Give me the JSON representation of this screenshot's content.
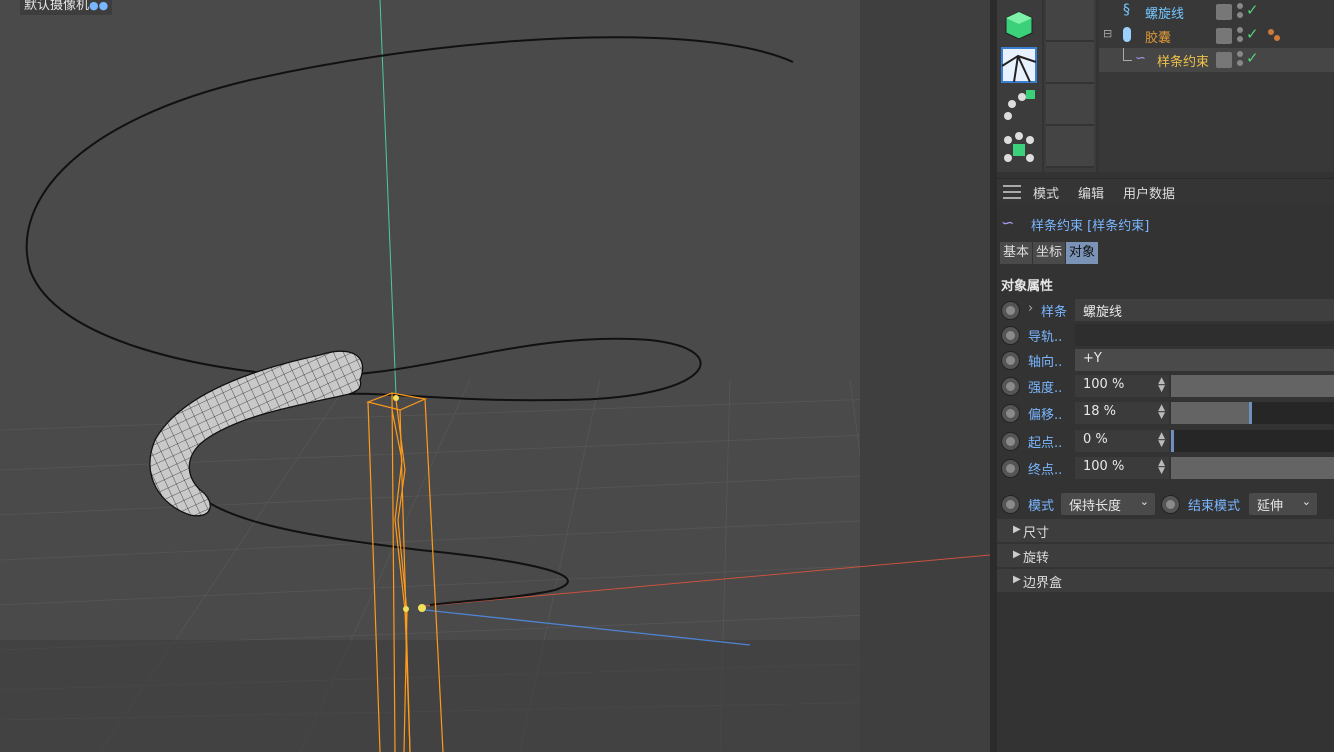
{
  "viewport": {
    "camera_label": "默认摄像机"
  },
  "object_manager": {
    "objects": [
      {
        "name": "螺旋线",
        "color": "#73c8ff"
      },
      {
        "name": "胶囊",
        "color": "#e09a3a"
      },
      {
        "name": "样条约束",
        "color": "#f0c24a"
      }
    ]
  },
  "attributes": {
    "menu": [
      "模式",
      "编辑",
      "用户数据"
    ],
    "title": "样条约束 [样条约束]",
    "tabs": [
      "基本",
      "坐标",
      "对象"
    ],
    "active_tab": "对象",
    "section": "对象属性",
    "params": {
      "spline": {
        "label": "样条",
        "value": "螺旋线"
      },
      "rail": {
        "label": "导轨..",
        "value": ""
      },
      "axis": {
        "label": "轴向..",
        "value": "+Y"
      },
      "strength": {
        "label": "强度..",
        "value": "100 %",
        "level": 1.0
      },
      "offset": {
        "label": "偏移..",
        "value": "18 %",
        "level": 0.18
      },
      "start": {
        "label": "起点..",
        "value": "0 %",
        "level": 0.0
      },
      "end": {
        "label": "终点..",
        "value": "100 %",
        "level": 1.0
      }
    },
    "mode": {
      "label": "模式",
      "value": "保持长度"
    },
    "end_mode": {
      "label": "结束模式",
      "value": "延伸"
    },
    "groups": [
      "尺寸",
      "旋转",
      "边界盒"
    ]
  },
  "colors": {
    "accent_label": "#7ab6ff",
    "active_tab": "#7b93b7",
    "check": "#56d27a",
    "selection_orange": "#ff9a1a"
  }
}
